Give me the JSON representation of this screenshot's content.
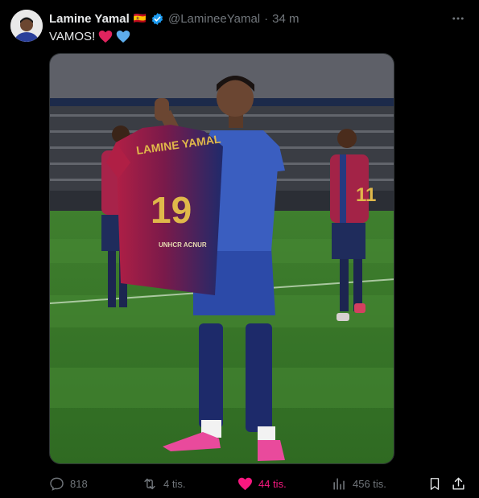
{
  "post": {
    "author_name": "Lamine Yamal",
    "flag": "🇪🇸",
    "verified": true,
    "handle": "@LamineeYamal",
    "separator": "·",
    "time": "34 m",
    "text": "VAMOS!",
    "emojis": [
      "red-heart",
      "blue-heart"
    ]
  },
  "media": {
    "jersey_name": "LAMINE YAMAL",
    "jersey_number": "19",
    "jersey_sponsor": "UNHCR ACNUR",
    "background_player_number": "11"
  },
  "actions": {
    "replies": "818",
    "reposts": "4 tis.",
    "likes": "44 tis.",
    "views": "456 tis."
  },
  "colors": {
    "background": "#000000",
    "text": "#e7e9ea",
    "muted": "#71767b",
    "verified": "#1d9bf0",
    "like": "#f91880"
  }
}
